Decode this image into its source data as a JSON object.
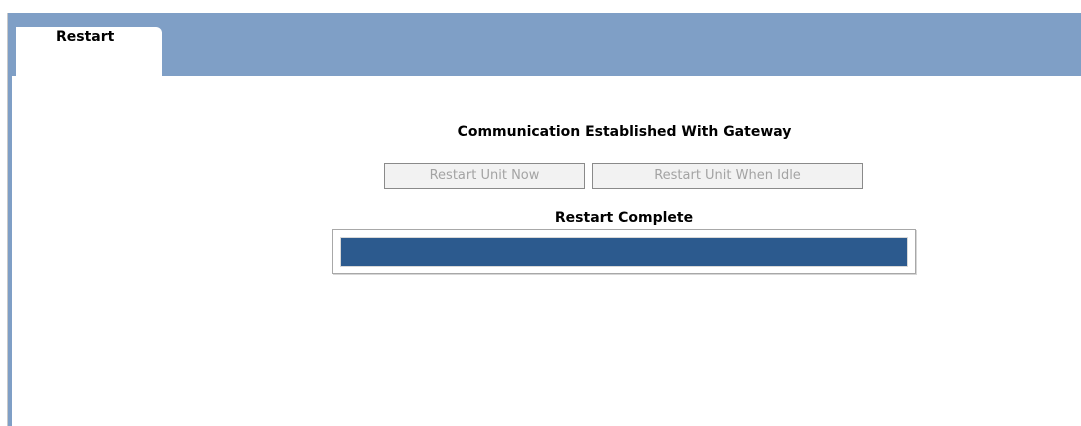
{
  "tabs": [
    {
      "label": "Restart",
      "active": true
    }
  ],
  "restart": {
    "connection_status": "Communication Established With Gateway",
    "buttons": {
      "restart_now": "Restart Unit Now",
      "restart_when_idle": "Restart Unit When Idle"
    },
    "status_text": "Restart Complete",
    "progress_fraction": 1.0
  },
  "colors": {
    "tab_bar": "#7f9fc6",
    "progress_fill": "#2c5a8e"
  }
}
